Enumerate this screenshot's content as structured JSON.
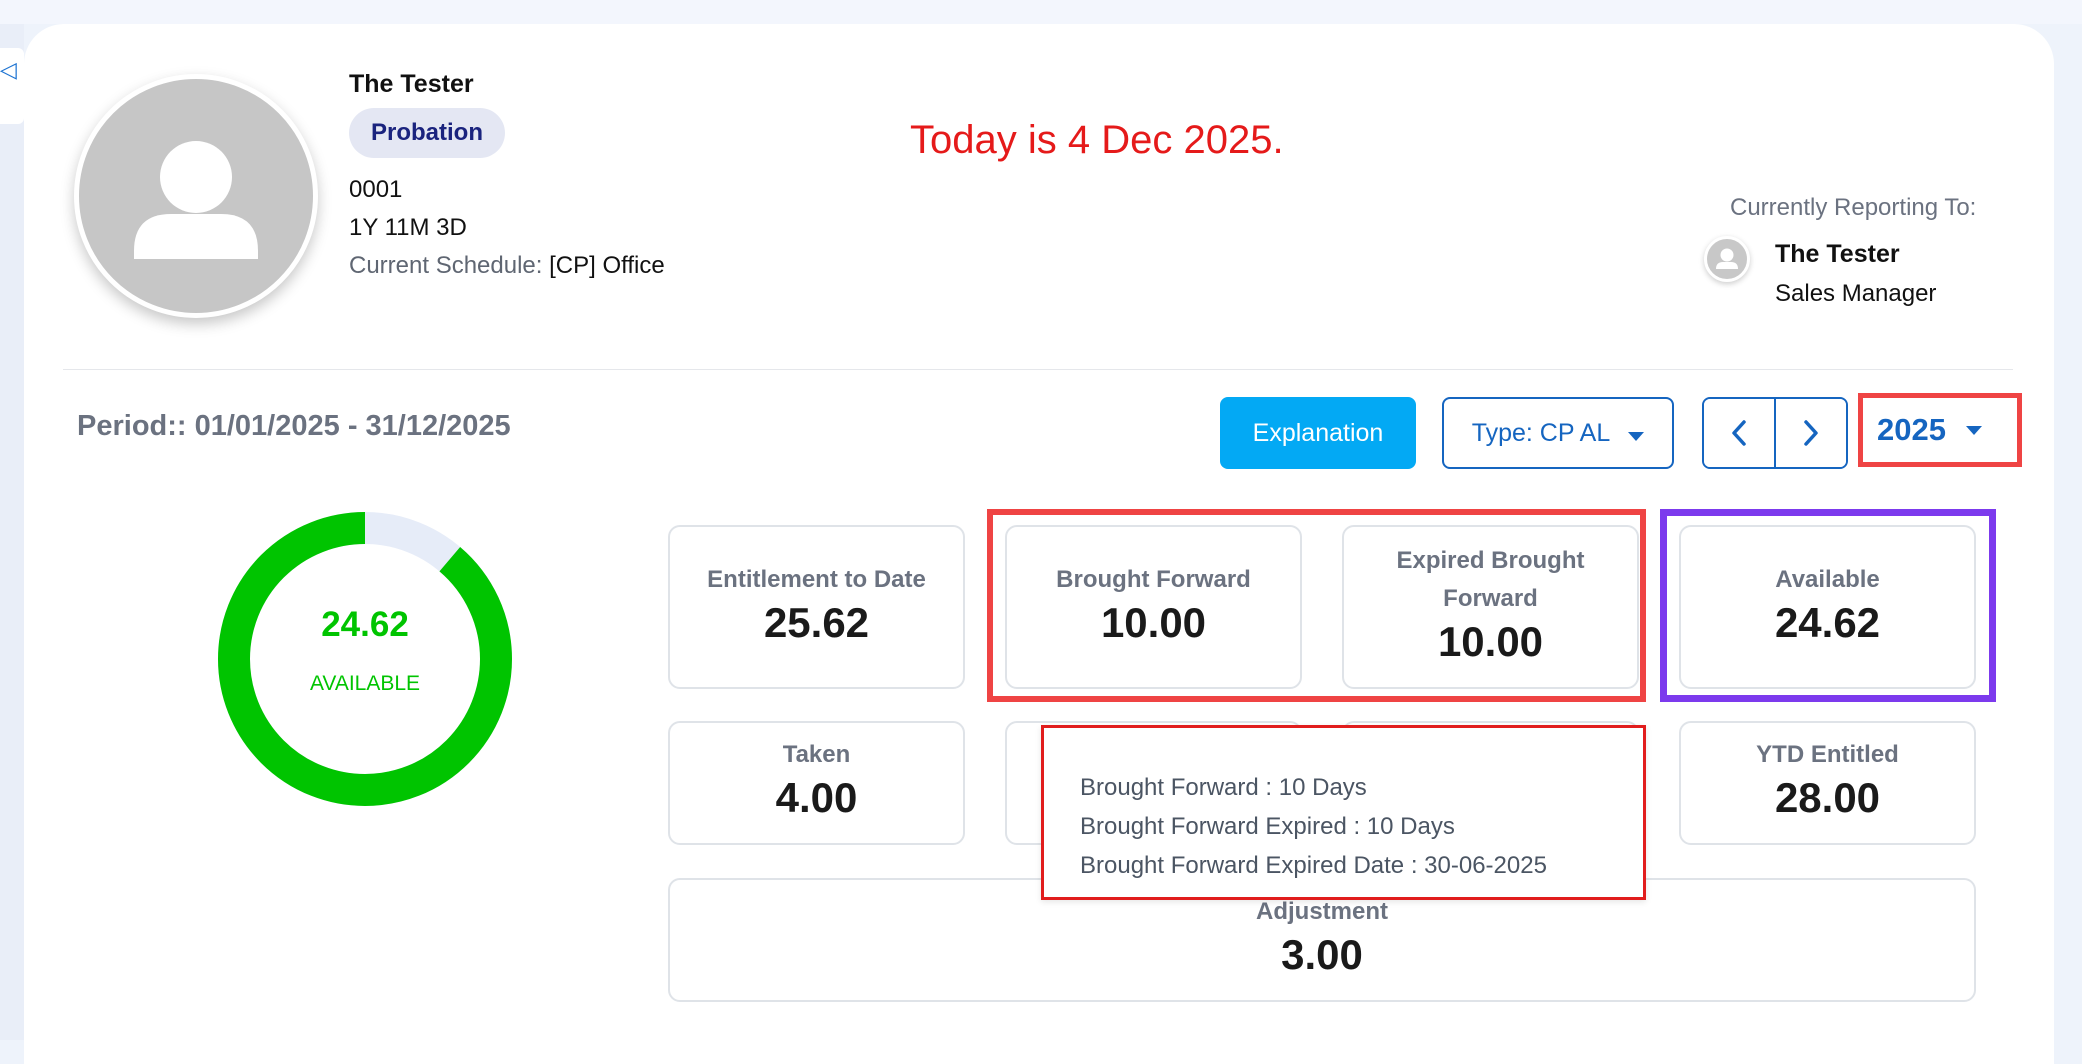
{
  "employee": {
    "name": "The Tester",
    "status_badge": "Probation",
    "id": "0001",
    "tenure": "1Y 11M 3D",
    "schedule_label": "Current Schedule:",
    "schedule_value": "[CP] Office"
  },
  "annotation": {
    "today_note": "Today is 4 Dec 2025."
  },
  "reporting": {
    "label": "Currently Reporting To:",
    "name": "The Tester",
    "title": "Sales Manager"
  },
  "period": {
    "text": "Period:: 01/01/2025 - 31/12/2025"
  },
  "toolbar": {
    "explanation_label": "Explanation",
    "type_label": "Type: CP AL",
    "prev_icon": "chevron-left-icon",
    "next_icon": "chevron-right-icon",
    "year_value": "2025"
  },
  "donut": {
    "value": "24.62",
    "label": "AVAILABLE",
    "available_fraction": 0.888,
    "fill_color": "#00c400",
    "remaining_color": "#e6ecf8"
  },
  "stats": {
    "entitlement_to_date": {
      "label": "Entitlement to Date",
      "value": "25.62"
    },
    "brought_forward": {
      "label": "Brought Forward",
      "value": "10.00"
    },
    "expired_brought_forward": {
      "label_line1": "Expired Brought",
      "label_line2": "Forward",
      "value": "10.00"
    },
    "available": {
      "label": "Available",
      "value": "24.62"
    },
    "taken": {
      "label": "Taken",
      "value": "4.00"
    },
    "ytd_entitled": {
      "label": "YTD Entitled",
      "value": "28.00"
    },
    "adjustment": {
      "label": "Adjustment",
      "value": "3.00"
    }
  },
  "tooltip": {
    "line1": "Brought Forward : 10 Days",
    "line2": "Brought Forward Expired : 10 Days",
    "line3": "Brought Forward Expired Date : 30-06-2025"
  },
  "colors": {
    "highlight_red": "#ef4444",
    "highlight_purple": "#7c3aed",
    "primary_blue": "#1565c0",
    "accent_cyan": "#03a9f4"
  }
}
